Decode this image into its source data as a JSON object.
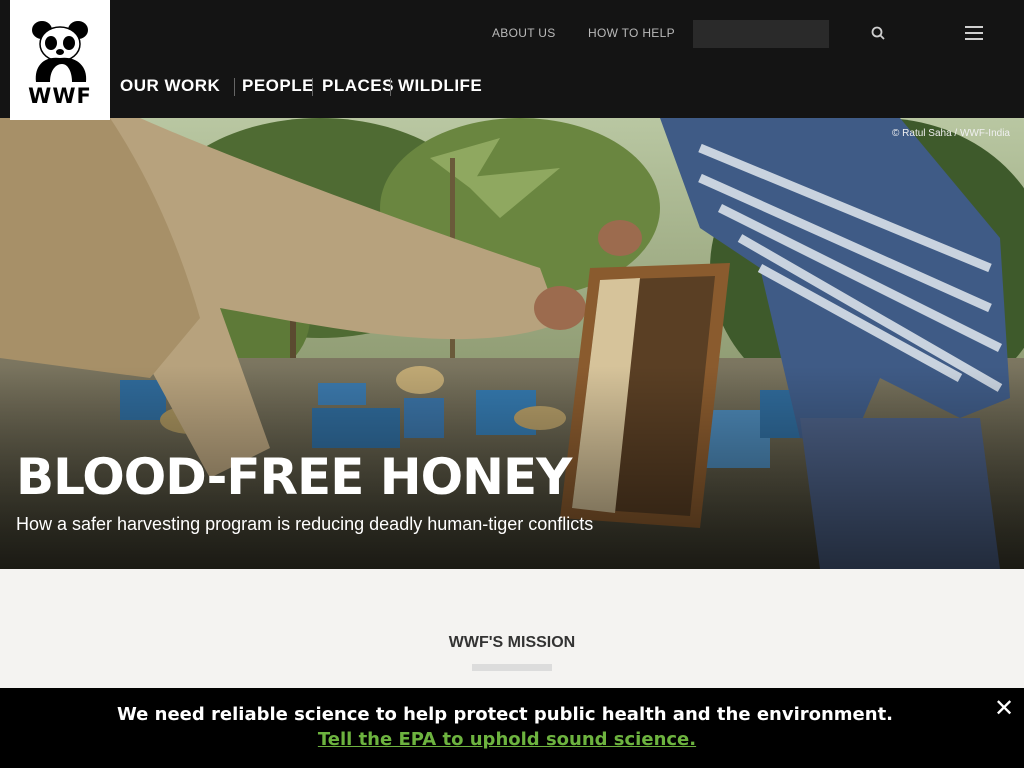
{
  "header": {
    "logo_text": "WWF",
    "top_links": [
      "ABOUT US",
      "HOW TO HELP"
    ],
    "search": {
      "placeholder": ""
    },
    "nav": [
      "OUR WORK",
      "PEOPLE",
      "PLACES",
      "WILDLIFE"
    ]
  },
  "hero": {
    "credit": "© Ratul Saha / WWF-India",
    "title": "BLOOD-FREE HONEY",
    "subtitle": "How a safer harvesting program is reducing deadly human-tiger conflicts"
  },
  "mission": {
    "heading": "WWF'S MISSION"
  },
  "banner": {
    "text": "We need reliable science to help protect public health and the environment.",
    "link": "Tell the EPA to uphold sound science.",
    "close_icon": "close-icon"
  },
  "colors": {
    "header_bg": "#141414",
    "banner_bg": "#000000",
    "link_green": "#6db33f",
    "page_bg": "#f4f3f1"
  }
}
